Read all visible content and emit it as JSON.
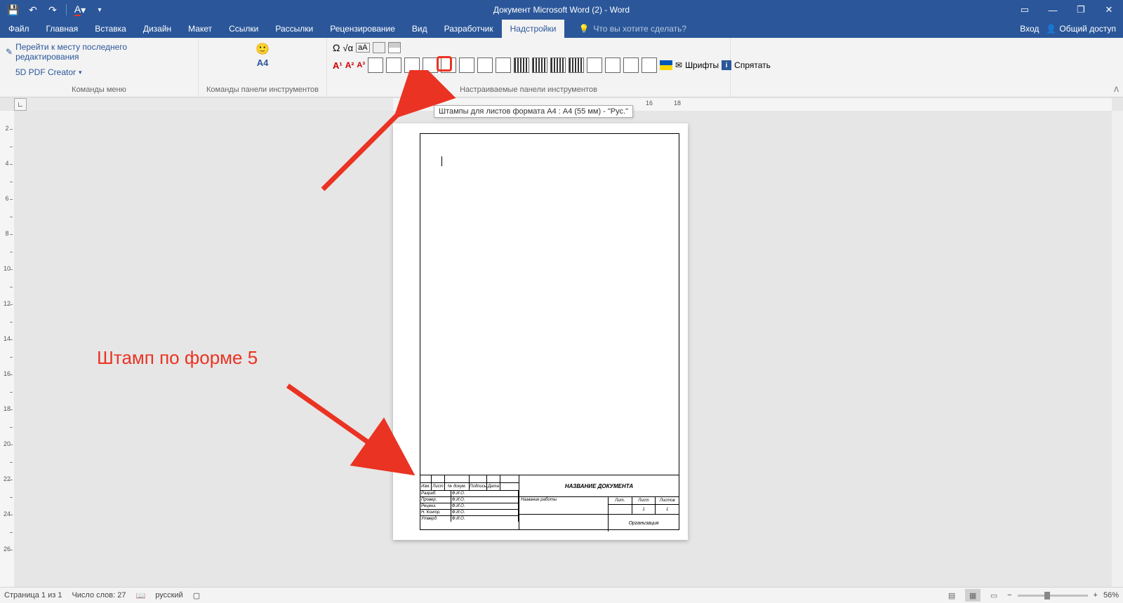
{
  "title": "Документ Microsoft Word (2) - Word",
  "tabs": [
    "Файл",
    "Главная",
    "Вставка",
    "Дизайн",
    "Макет",
    "Ссылки",
    "Рассылки",
    "Рецензирование",
    "Вид",
    "Разработчик",
    "Надстройки"
  ],
  "active_tab": "Надстройки",
  "tellme": "Что вы хотите сделать?",
  "signin": "Вход",
  "share": "Общий доступ",
  "ribbon": {
    "group1": {
      "goto_edit": "Перейти к месту последнего редактирования",
      "pdf_creator": "5D PDF Creator",
      "label": "Команды меню"
    },
    "group2": {
      "a4": "А4",
      "label": "Команды панели инструментов"
    },
    "group3": {
      "fonts": "Шрифты",
      "hide": "Спрятать",
      "label": "Настраиваемые панели инструментов"
    }
  },
  "tooltip": "Штампы для листов формата А4 : А4 (55 мм) - \"Рус.\"",
  "ruler_h_nums": {
    "n16": "16",
    "n18": "18"
  },
  "annotation": "Штамп по форме 5",
  "titleblock": {
    "doc_title": "НАЗВАНИЕ ДОКУМЕНТА",
    "work_title": "Название работы",
    "org": "Организация",
    "hdr": {
      "izm": "Изм.",
      "list": "Лист",
      "ndok": "№ докум.",
      "podp": "Подпись",
      "data": "Дата"
    },
    "rows": [
      "Разраб.",
      "Провер.",
      "Реценз.",
      "Н. Контр.",
      "Утверд."
    ],
    "fio": "Ф.И.О.",
    "lit": "Лит.",
    "sheet": "Лист",
    "sheets": "Листов",
    "val_sheet": "1",
    "val_sheets": "1"
  },
  "status": {
    "page": "Страница 1 из 1",
    "words": "Число слов: 27",
    "lang": "русский",
    "zoom": "56%"
  },
  "vruler": [
    "2",
    "",
    "4",
    "",
    "6",
    "",
    "8",
    "",
    "10",
    "",
    "12",
    "",
    "14",
    "",
    "16",
    "",
    "18",
    "",
    "20",
    "",
    "22",
    "",
    "24",
    "",
    "26"
  ]
}
